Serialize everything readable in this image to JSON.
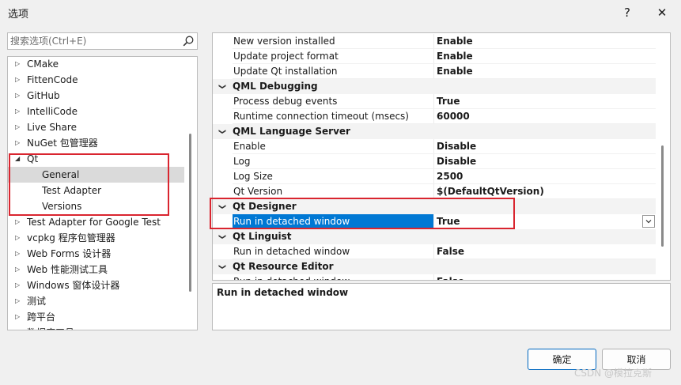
{
  "window": {
    "title": "选项",
    "help_label": "?",
    "close_label": "✕"
  },
  "search": {
    "placeholder": "搜索选项(Ctrl+E)"
  },
  "tree": {
    "items": [
      {
        "label": "CMake",
        "expanded": false
      },
      {
        "label": "FittenCode",
        "expanded": false
      },
      {
        "label": "GitHub",
        "expanded": false
      },
      {
        "label": "IntelliCode",
        "expanded": false
      },
      {
        "label": "Live Share",
        "expanded": false
      },
      {
        "label": "NuGet 包管理器",
        "expanded": false
      },
      {
        "label": "Qt",
        "expanded": true
      },
      {
        "label": "General",
        "child": true,
        "selected": true
      },
      {
        "label": "Test Adapter",
        "child": true
      },
      {
        "label": "Versions",
        "child": true
      },
      {
        "label": "Test Adapter for Google Test",
        "expanded": false
      },
      {
        "label": "vcpkg 程序包管理器",
        "expanded": false
      },
      {
        "label": "Web Forms 设计器",
        "expanded": false
      },
      {
        "label": "Web 性能测试工具",
        "expanded": false
      },
      {
        "label": "Windows 窗体设计器",
        "expanded": false
      },
      {
        "label": "测试",
        "expanded": false
      },
      {
        "label": "跨平台",
        "expanded": false
      },
      {
        "label": "数据库工具",
        "expanded": false
      }
    ]
  },
  "grid": {
    "rows": [
      {
        "type": "prop",
        "name": "New version installed",
        "value": "Enable"
      },
      {
        "type": "prop",
        "name": "Update project format",
        "value": "Enable"
      },
      {
        "type": "prop",
        "name": "Update Qt installation",
        "value": "Enable"
      },
      {
        "type": "cat",
        "name": "QML Debugging"
      },
      {
        "type": "prop",
        "name": "Process debug events",
        "value": "True"
      },
      {
        "type": "prop",
        "name": "Runtime connection timeout (msecs)",
        "value": "60000"
      },
      {
        "type": "cat",
        "name": "QML Language Server"
      },
      {
        "type": "prop",
        "name": "Enable",
        "value": "Disable"
      },
      {
        "type": "prop",
        "name": "Log",
        "value": "Disable"
      },
      {
        "type": "prop",
        "name": "Log Size",
        "value": "2500"
      },
      {
        "type": "prop",
        "name": "Qt Version",
        "value": "$(DefaultQtVersion)"
      },
      {
        "type": "cat",
        "name": "Qt Designer"
      },
      {
        "type": "prop",
        "name": "Run in detached window",
        "value": "True",
        "selected": true
      },
      {
        "type": "cat",
        "name": "Qt Linguist"
      },
      {
        "type": "prop",
        "name": "Run in detached window",
        "value": "False"
      },
      {
        "type": "cat",
        "name": "Qt Resource Editor"
      },
      {
        "type": "prop",
        "name": "Run in detached window",
        "value": "False"
      }
    ]
  },
  "description": {
    "title": "Run in detached window"
  },
  "buttons": {
    "ok": "确定",
    "cancel": "取消"
  },
  "watermark": "CSDN @模拉克斯"
}
